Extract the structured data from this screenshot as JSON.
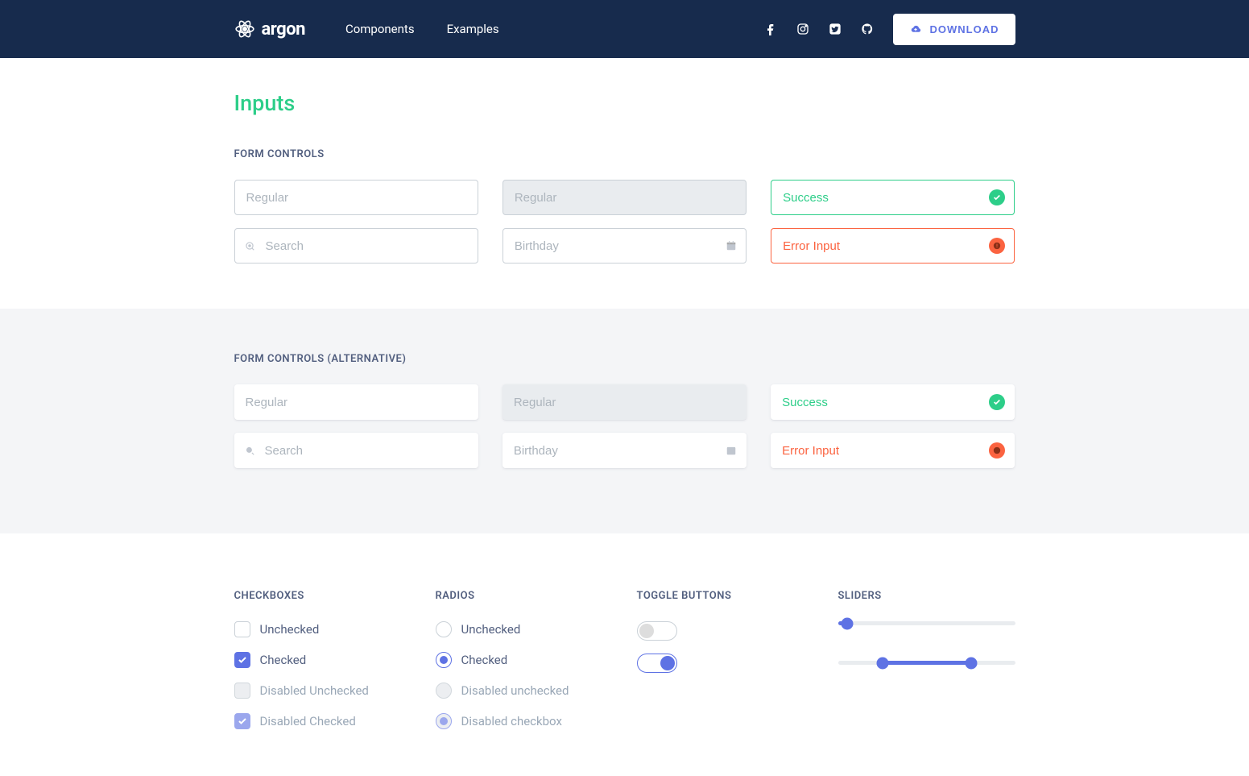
{
  "brand": "argon",
  "nav": {
    "components": "Components",
    "examples": "Examples",
    "download": "DOWNLOAD"
  },
  "page_title": "Inputs",
  "section1": {
    "heading": "FORM CONTROLS",
    "regular_ph": "Regular",
    "search_ph": "Search",
    "birthday_ph": "Birthday",
    "success_val": "Success",
    "error_val": "Error Input"
  },
  "section2": {
    "heading": "FORM CONTROLS (ALTERNATIVE)",
    "regular_ph": "Regular",
    "search_ph": "Search",
    "birthday_ph": "Birthday",
    "success_val": "Success",
    "error_val": "Error Input"
  },
  "checkboxes": {
    "heading": "CHECKBOXES",
    "unchecked": "Unchecked",
    "checked": "Checked",
    "disabled_unchecked": "Disabled Unchecked",
    "disabled_checked": "Disabled Checked"
  },
  "radios": {
    "heading": "RADIOS",
    "unchecked": "Unchecked",
    "checked": "Checked",
    "disabled_unchecked": "Disabled unchecked",
    "disabled_checked": "Disabled checkbox"
  },
  "toggles": {
    "heading": "TOGGLE BUTTONS"
  },
  "sliders": {
    "heading": "SLIDERS",
    "single": {
      "value": 5,
      "min": 0,
      "max": 100
    },
    "range": {
      "low": 25,
      "high": 75,
      "min": 0,
      "max": 100
    }
  },
  "colors": {
    "primary": "#5e72e4",
    "success": "#2dce89",
    "warning": "#fb6340",
    "navbar": "#172b4d"
  }
}
